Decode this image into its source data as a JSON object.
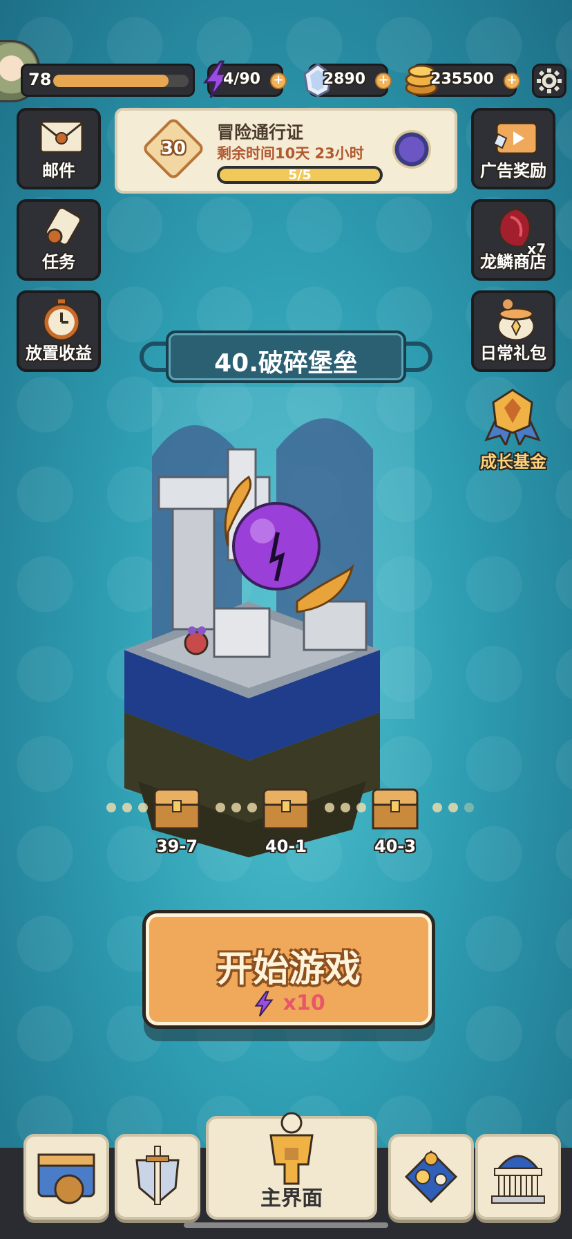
{
  "player": {
    "level": "78",
    "xp_progress": 0.85
  },
  "resources": {
    "energy": "4/90",
    "gems": "2890",
    "coins": "235500",
    "plus_symbol": "+"
  },
  "left_buttons": [
    {
      "label": "邮件",
      "icon": "mail-icon"
    },
    {
      "label": "任务",
      "icon": "scroll-icon"
    },
    {
      "label": "放置收益",
      "icon": "stopwatch-icon"
    }
  ],
  "right_buttons": [
    {
      "label": "广告奖励",
      "icon": "tv-icon"
    },
    {
      "label": "龙鳞商店",
      "icon": "dragon-scale-icon",
      "badge": "x7"
    },
    {
      "label": "日常礼包",
      "icon": "gift-pot-icon"
    },
    {
      "label": "成长基金",
      "icon": "medal-icon"
    }
  ],
  "pass": {
    "level": "30",
    "title": "冒险通行证",
    "subtitle": "剩余时间10天 23小时",
    "progress_text": "5/5",
    "progress": 1.0
  },
  "stage": {
    "title": "40.破碎堡垒"
  },
  "chests": [
    {
      "label": "39-7"
    },
    {
      "label": "40-1"
    },
    {
      "label": "40-3"
    }
  ],
  "start": {
    "label": "开始游戏",
    "cost": "x10"
  },
  "nav": {
    "main_label": "主界面",
    "items": [
      "chest-icon",
      "sword-shield-icon",
      "armor-icon",
      "talent-icon",
      "museum-icon"
    ]
  },
  "colors": {
    "accent_orange": "#f0a85a",
    "energy_purple": "#9a4de0",
    "background_teal": "#2e9db2"
  }
}
